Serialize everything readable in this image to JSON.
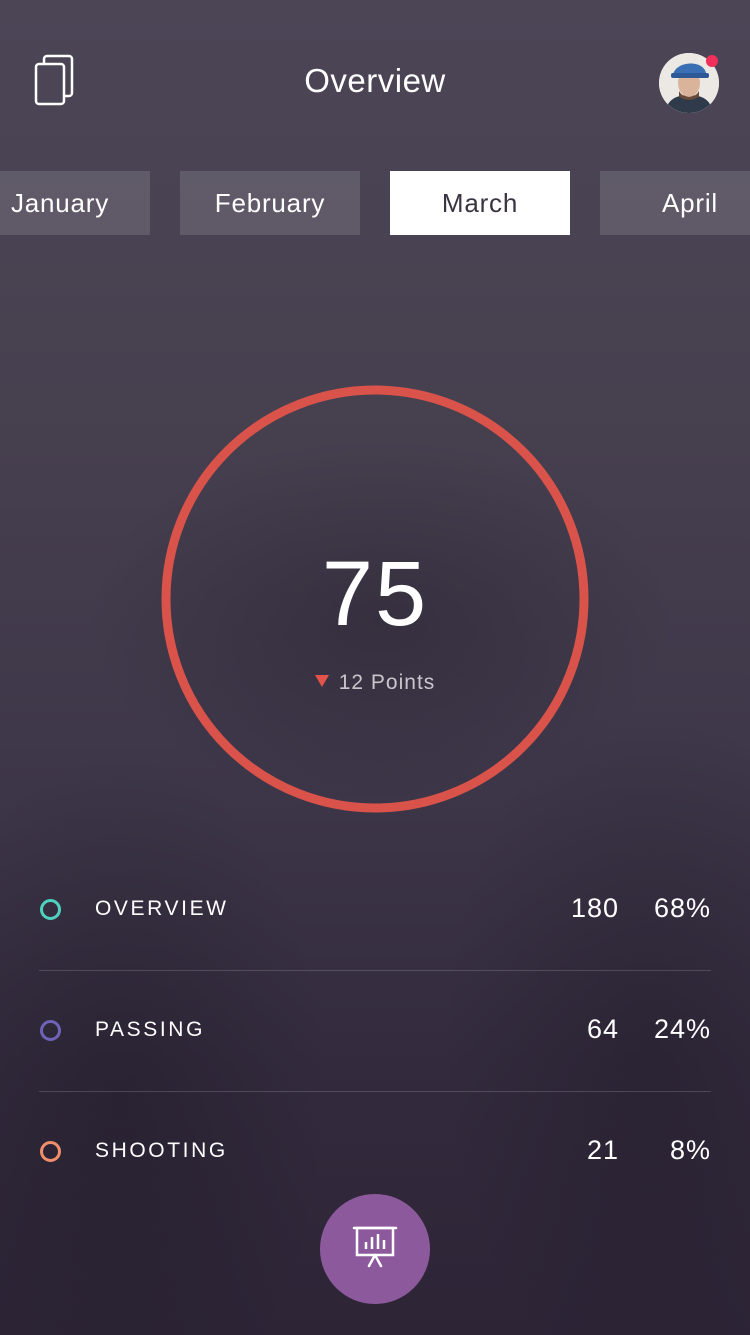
{
  "header": {
    "title": "Overview",
    "left_icon": "cards-icon",
    "avatar_icon": "avatar-icon",
    "notification_color": "#f0305a"
  },
  "months": [
    {
      "label": "January",
      "active": false
    },
    {
      "label": "February",
      "active": false
    },
    {
      "label": "March",
      "active": true
    },
    {
      "label": "April",
      "active": false
    }
  ],
  "score": {
    "value": "75",
    "change": "12 Points",
    "change_direction": "down",
    "ring_color": "#d9534b"
  },
  "stats": [
    {
      "label": "OVERVIEW",
      "count": "180",
      "percent": "68%",
      "color": "#4fd1c0"
    },
    {
      "label": "PASSING",
      "count": "64",
      "percent": "24%",
      "color": "#6f63b8"
    },
    {
      "label": "SHOOTING",
      "count": "21",
      "percent": "8%",
      "color": "#f08f6a"
    }
  ],
  "fab": {
    "icon": "presentation-chart-icon",
    "color": "#8c5a9c"
  }
}
